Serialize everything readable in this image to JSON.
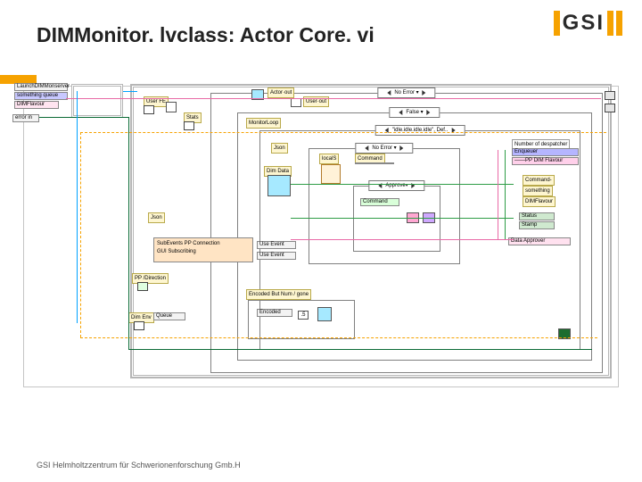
{
  "slide": {
    "title": "DIMMonitor. lvclass: Actor Core. vi",
    "footer": "GSI Helmholtzzentrum für Schwerionenforschung Gmb.H",
    "logo_text": "GSI"
  },
  "diagram": {
    "top_labels": {
      "launch_actor": "LaunchDIMMonserver",
      "enqueuer": "something queue",
      "dim_flavour": "DIMFlavour",
      "error_in": "error in",
      "user_fe": "User FE",
      "stats": "Stats",
      "actor_out": "Actor·out",
      "user_out": "User·out",
      "no_error_true": "No Error ▾",
      "false_case": "False ▾",
      "case_idle": "\"idle.idle.idle.idle\", Def..",
      "monitor_loop": "MonitorLoop"
    },
    "right_labels": {
      "despatcher": "Number of despatcher",
      "enqueuer_out": "Enqueuer",
      "pp_flavour": "——PP DIM Flavour",
      "cmd_out": "Command-",
      "something": "something",
      "flavour_out": "DIMFlavour",
      "status": "Status",
      "stamp": "Stamp",
      "data_approver": "Data Approver"
    },
    "mid_labels": {
      "json": "Json",
      "dim_data": "Dim Data",
      "local_s": "localS",
      "no_err2": "No Error ▾",
      "command": "Command",
      "command2": "Command",
      "approve": "Approve▾"
    },
    "left_labels": {
      "pp_direction": "PP /Direction",
      "dim_env": "Dim Env",
      "queue": "Queue",
      "subevents": "SubEvents PP Connection",
      "sub2": "GUI Subscribing",
      "use_event": "Use Event",
      "use_event2": "Use Event",
      "encoded_but": "Encoded But Num / gone",
      "encoded": "Encoded",
      "half": ".5"
    }
  }
}
